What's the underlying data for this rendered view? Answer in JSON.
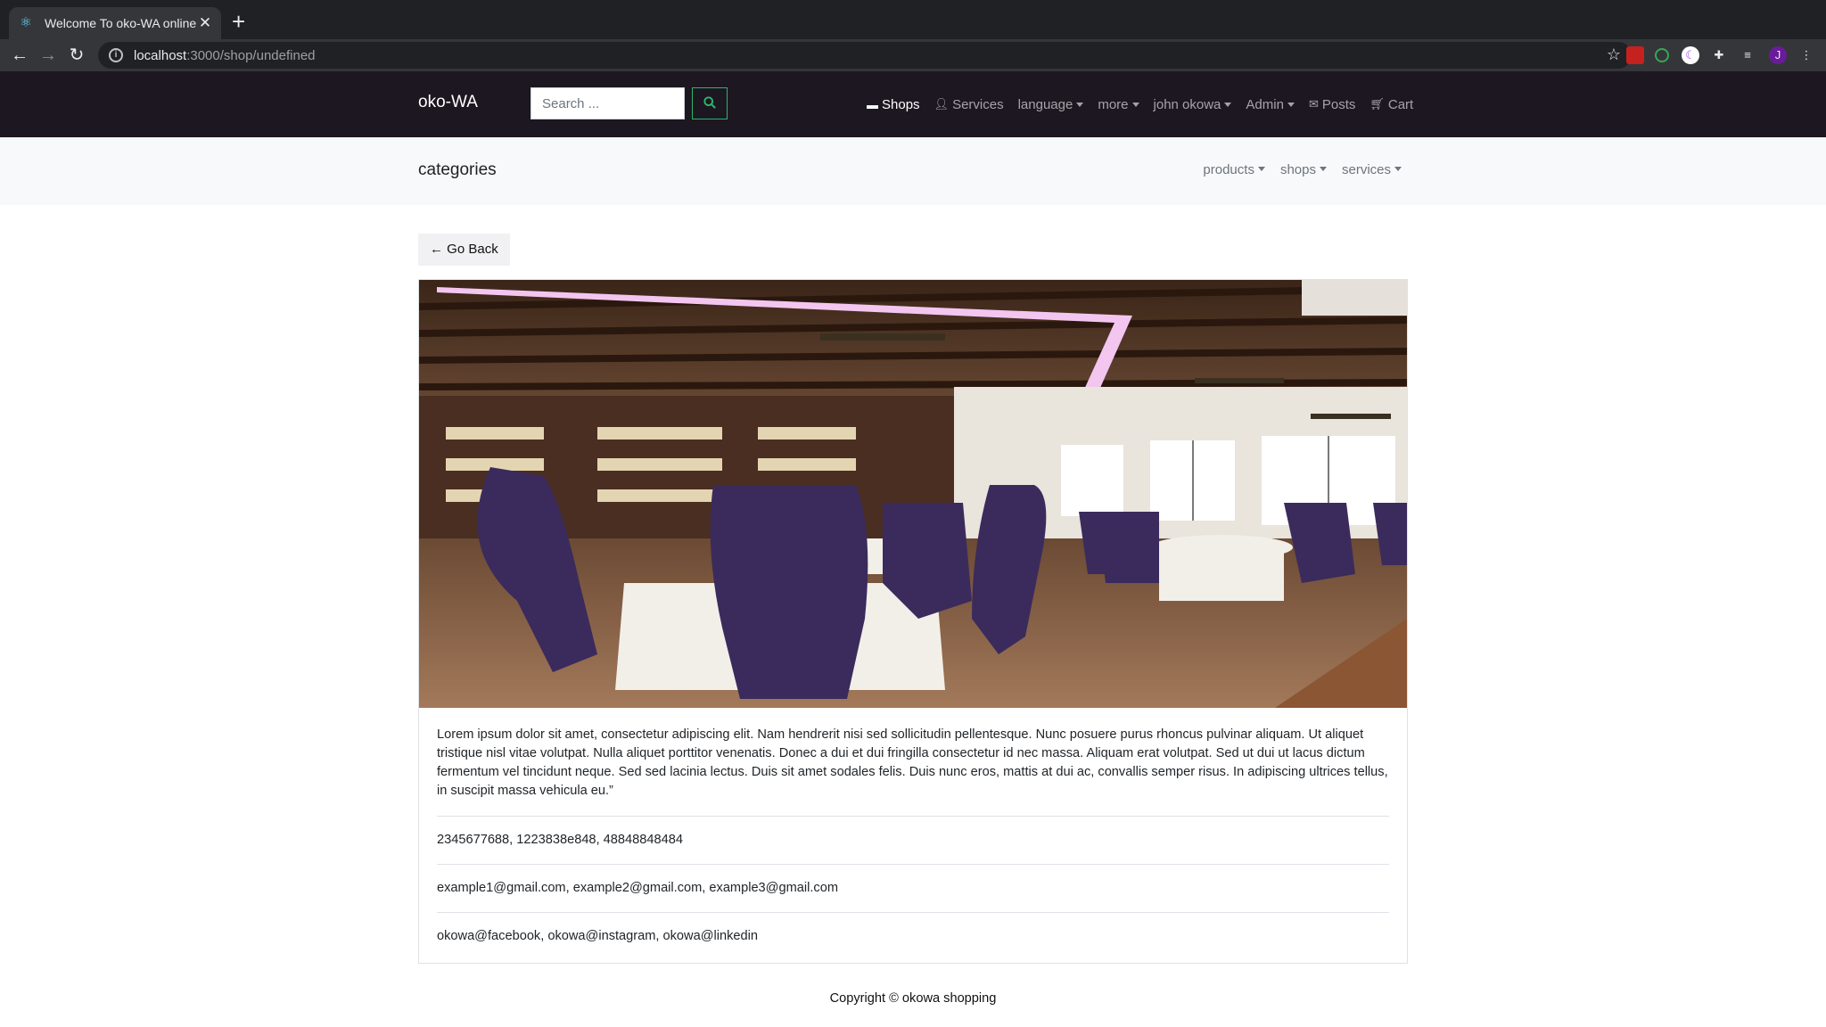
{
  "browser": {
    "tab_title": "Welcome To oko-WA online St",
    "url_host": "localhost",
    "url_rest": ":3000/shop/undefined",
    "profile_initial": "J"
  },
  "navbar": {
    "brand": "oko-WA",
    "search_placeholder": "Search ...",
    "links": [
      {
        "label": "Shops",
        "icon": "store-icon",
        "active": true
      },
      {
        "label": "Services",
        "icon": "person-icon"
      },
      {
        "label": "language",
        "dropdown": true
      },
      {
        "label": "more",
        "dropdown": true
      },
      {
        "label": "john okowa",
        "dropdown": true
      },
      {
        "label": "Admin",
        "dropdown": true
      },
      {
        "label": "Posts",
        "icon": "envelope-icon"
      },
      {
        "label": "Cart",
        "icon": "cart-icon"
      }
    ]
  },
  "categories": {
    "title": "categories",
    "links": [
      "products",
      "shops",
      "services"
    ]
  },
  "content": {
    "go_back": "Go Back",
    "description": "Lorem ipsum dolor sit amet, consectetur adipiscing elit. Nam hendrerit nisi sed sollicitudin pellentesque. Nunc posuere purus rhoncus pulvinar aliquam. Ut aliquet tristique nisl vitae volutpat. Nulla aliquet porttitor venenatis. Donec a dui et dui fringilla consectetur id nec massa. Aliquam erat volutpat. Sed ut dui ut lacus dictum fermentum vel tincidunt neque. Sed sed lacinia lectus. Duis sit amet sodales felis. Duis nunc eros, mattis at dui ac, convallis semper risus. In adipiscing ultrices tellus, in suscipit massa vehicula eu.”",
    "phones": "2345677688, 1223838e848, 48848848484",
    "emails": "example1@gmail.com, example2@gmail.com, example3@gmail.com",
    "socials": "okowa@facebook, okowa@instagram, okowa@linkedin"
  },
  "footer": {
    "copyright": "Copyright © okowa shopping"
  },
  "colors": {
    "navbar_bg": "#1c1721",
    "search_btn": "#2fb36b",
    "catbar_bg": "#f8f9fa"
  }
}
